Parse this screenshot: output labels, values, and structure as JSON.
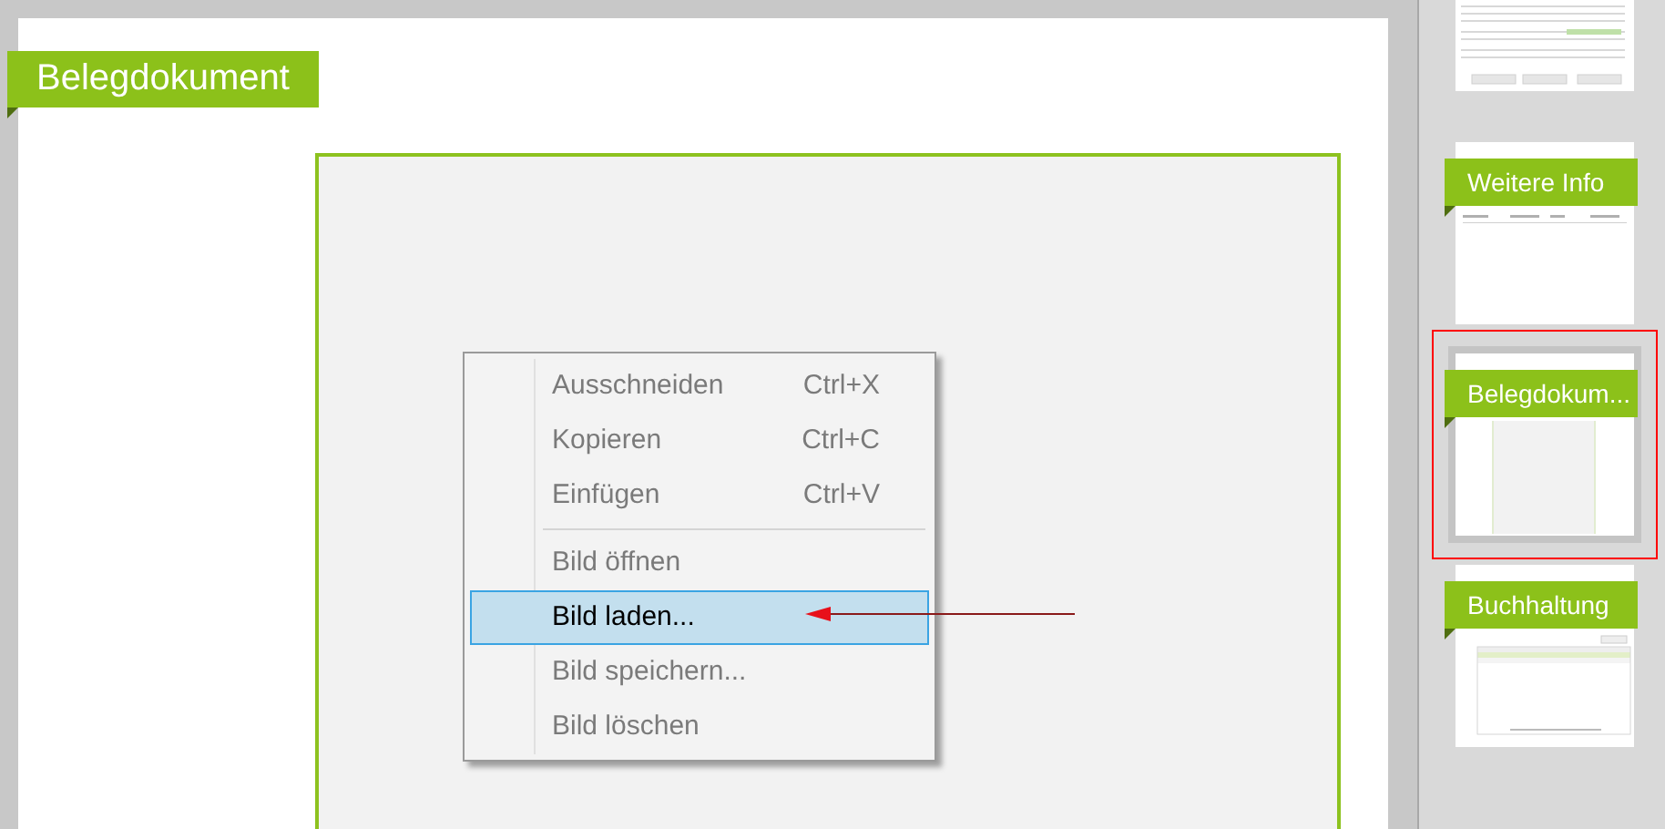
{
  "main": {
    "section_title": "Belegdokument"
  },
  "context_menu": {
    "items": [
      {
        "kind": "item",
        "label": "Ausschneiden",
        "shortcut": "Ctrl+X",
        "disabled": true,
        "selected": false
      },
      {
        "kind": "item",
        "label": "Kopieren",
        "shortcut": "Ctrl+C",
        "disabled": true,
        "selected": false
      },
      {
        "kind": "item",
        "label": "Einfügen",
        "shortcut": "Ctrl+V",
        "disabled": true,
        "selected": false
      },
      {
        "kind": "separator"
      },
      {
        "kind": "item",
        "label": "Bild öffnen",
        "disabled": true,
        "selected": false
      },
      {
        "kind": "item",
        "label": "Bild laden...",
        "disabled": false,
        "selected": true
      },
      {
        "kind": "item",
        "label": "Bild speichern...",
        "disabled": true,
        "selected": false
      },
      {
        "kind": "item",
        "label": "Bild löschen",
        "disabled": true,
        "selected": false
      }
    ]
  },
  "thumbnails": [
    {
      "kind": "form",
      "selected": false
    },
    {
      "kind": "list",
      "title": "Weitere Info",
      "selected": false
    },
    {
      "kind": "image",
      "title": "Belegdokum...",
      "selected": true
    },
    {
      "kind": "table",
      "title": "Buchhaltung",
      "selected": false
    }
  ]
}
